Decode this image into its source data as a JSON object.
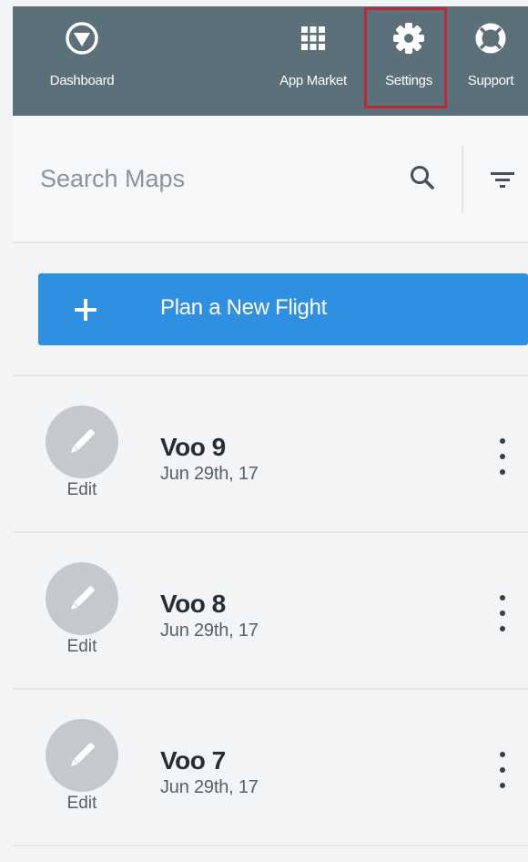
{
  "colors": {
    "nav_background": "#5b7078",
    "highlight_border": "#c1273a",
    "primary_button": "#2f8fe0",
    "edit_avatar": "#c5c9cd"
  },
  "nav": {
    "items": [
      {
        "label": "Dashboard",
        "icon": "compass-icon"
      },
      {
        "label": "App Market",
        "icon": "grid-icon"
      },
      {
        "label": "Settings",
        "icon": "gear-icon",
        "highlighted": true
      },
      {
        "label": "Support",
        "icon": "lifebuoy-icon"
      }
    ]
  },
  "search": {
    "placeholder": "Search Maps",
    "value": "",
    "search_icon": "search-icon",
    "filter_icon": "filter-icon"
  },
  "plan_button": {
    "icon": "plus-icon",
    "label": "Plan a New Flight"
  },
  "flights": [
    {
      "name": "Voo 9",
      "date": "Jun 29th, 17",
      "edit_label": "Edit"
    },
    {
      "name": "Voo 8",
      "date": "Jun 29th, 17",
      "edit_label": "Edit"
    },
    {
      "name": "Voo 7",
      "date": "Jun 29th, 17",
      "edit_label": "Edit"
    }
  ]
}
